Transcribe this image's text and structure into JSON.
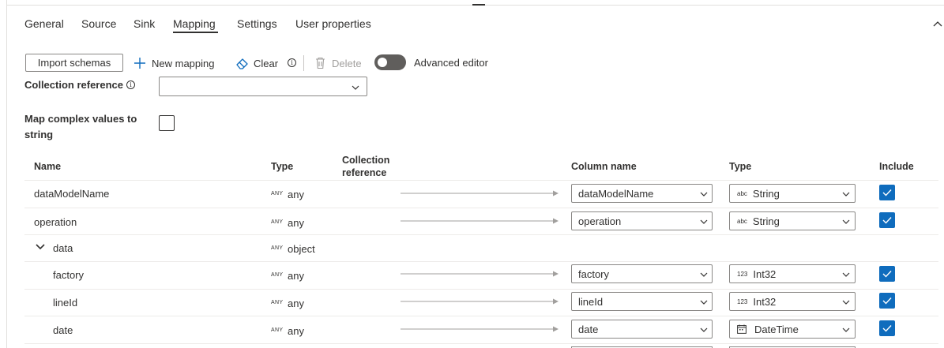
{
  "tabs": [
    {
      "label": "General"
    },
    {
      "label": "Source"
    },
    {
      "label": "Sink"
    },
    {
      "label": "Mapping"
    },
    {
      "label": "Settings"
    },
    {
      "label": "User properties"
    }
  ],
  "active_tab": "Mapping",
  "toolbar": {
    "import_label": "Import schemas",
    "new_mapping_label": "New mapping",
    "clear_label": "Clear",
    "delete_label": "Delete",
    "advanced_editor_label": "Advanced editor",
    "advanced_editor_on": false
  },
  "form": {
    "collection_reference_label": "Collection reference",
    "collection_reference_value": "",
    "map_complex_label_line1": "Map complex values to",
    "map_complex_label_line2": "string",
    "map_complex_checked": false
  },
  "grid": {
    "headers": {
      "name": "Name",
      "type": "Type",
      "collection_ref_line1": "Collection",
      "collection_ref_line2": "reference",
      "column_name": "Column name",
      "sink_type": "Type",
      "include": "Include"
    },
    "rows": [
      {
        "name": "dataModelName",
        "tag": "ANY",
        "type": "any",
        "sink_column": "dataModelName",
        "sink_glyph": "abc",
        "sink_type": "String",
        "include": true
      },
      {
        "name": "operation",
        "tag": "ANY",
        "type": "any",
        "sink_column": "operation",
        "sink_glyph": "abc",
        "sink_type": "String",
        "include": true
      },
      {
        "name": "data",
        "tag": "ANY",
        "type": "object",
        "expanded": true
      },
      {
        "name": "factory",
        "tag": "ANY",
        "type": "any",
        "sink_column": "factory",
        "sink_glyph": "123",
        "sink_type": "Int32",
        "include": true
      },
      {
        "name": "lineId",
        "tag": "ANY",
        "type": "any",
        "sink_column": "lineId",
        "sink_glyph": "123",
        "sink_type": "Int32",
        "include": true
      },
      {
        "name": "date",
        "tag": "ANY",
        "type": "any",
        "sink_column": "date",
        "sink_glyph": "calendar-icon",
        "sink_type": "DateTime",
        "include": true
      }
    ]
  },
  "colors": {
    "accent": "#0f6cbd",
    "text": "#323130",
    "border": "#8a8886",
    "toggle_off": "#605e5c"
  }
}
